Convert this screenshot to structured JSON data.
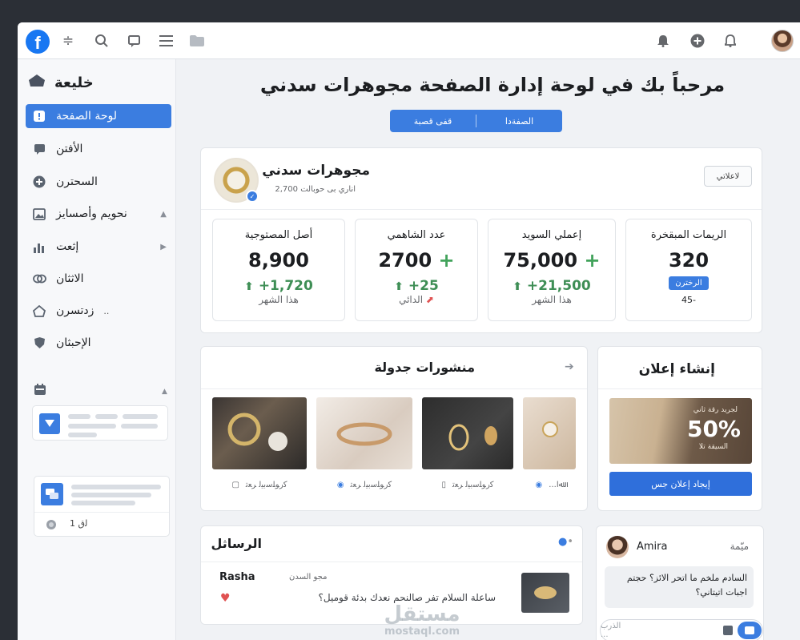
{
  "topbar": {
    "logo": "f",
    "icons": [
      "sliders-icon",
      "search-icon",
      "messages-icon",
      "menu-icon",
      "folder-icon",
      "bell-icon",
      "plus-circle-icon",
      "notifications-icon"
    ]
  },
  "sidebar": {
    "title": "خليعة",
    "items": [
      {
        "label": "لوحة الصفحة",
        "icon": "alert-icon"
      },
      {
        "label": "الأفتن",
        "icon": "chat-icon"
      },
      {
        "label": "السحترن",
        "icon": "plus-icon"
      },
      {
        "label": "نحويم وأصسايز",
        "icon": "image-icon"
      },
      {
        "label": "إثعت",
        "icon": "bar-chart-icon"
      },
      {
        "label": "الاثثان",
        "icon": "link-icon"
      },
      {
        "label": "زدتسرن",
        "icon": "home-icon",
        "suffix": ".."
      },
      {
        "label": "الإحبثان",
        "icon": "shield-icon"
      }
    ],
    "page_count_label": "1 ﻟﻕ"
  },
  "main": {
    "welcome": "مرحباً بك في لوحة إدارة الصفحة مجوهرات سدني",
    "segment": {
      "left": "قفى قصبة",
      "right": "الصفةدا"
    },
    "page_card": {
      "name": "مجوهرات سدني",
      "subtitle": "اناري بى حوبالت 2,700",
      "action": "لاعلاتي"
    },
    "stats": [
      {
        "label": "الريمات المبقخرة",
        "value": "320",
        "pill": "الرخترن",
        "extra": "45-"
      },
      {
        "label": "إعملي السويد",
        "value": "75,000",
        "plus": "+",
        "change": "+21,500",
        "period": "هذا الشهر"
      },
      {
        "label": "عدد الشاهمي",
        "value": "2700",
        "plus": "+",
        "change": "+25",
        "period": "الدائي"
      },
      {
        "label": "أصل المصتوجية",
        "value": "8,900",
        "change": "+1,720",
        "period": "هذا الشهر"
      }
    ],
    "scheduled": {
      "title": "منشورات جدولة",
      "posts": [
        {
          "caption": "ﻛﺭﻮﻠﺳﺑﻴﻟ ﺮﻌﺗ"
        },
        {
          "caption": "ﻛﺭﻮﻠﺳﺑﻴﻟ ﺮﻌﺗ"
        },
        {
          "caption": "ﻛﺭﻮﻠﺳﺑﻴﻟ ﺮﻌﺗ"
        },
        {
          "caption": "...ﷲا"
        }
      ]
    },
    "ad": {
      "title": "إنشاء إعلان",
      "percent": "50%",
      "line1": "لجريد رقة ثاني",
      "line2": "السيقة تلا",
      "button": "إيجاد إعلان جس"
    },
    "messages": {
      "title": "الرساثل",
      "sender": "Rasha",
      "sender_sub": "مجو السدن",
      "body": "ساعلة السلام تفر صالنحم نعدك بدئة قوميل؟"
    },
    "chat": {
      "label": "ميّمة",
      "name": "Amira",
      "bubble": "السادم ملخم ما اتحر الائز؟ حجتم اجبات اتيتاني؟",
      "input_placeholder": "الذرب ..."
    }
  },
  "watermark": {
    "arabic": "مستقل",
    "latin": "mostaql.com"
  },
  "colors": {
    "accent": "#3b7de0",
    "positive": "#3e8e55",
    "brand": "#1877f2"
  }
}
